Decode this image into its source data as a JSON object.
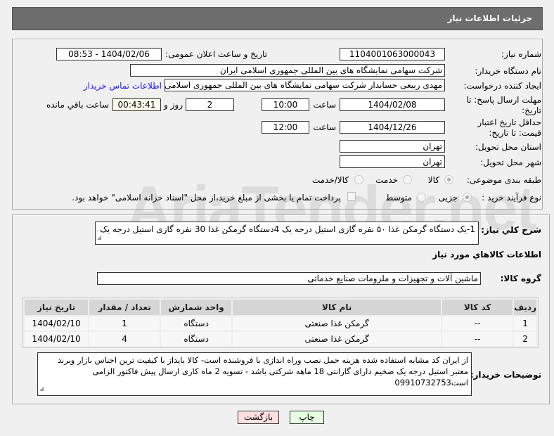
{
  "header": {
    "title": "جزئیات اطلاعات نیاز"
  },
  "form": {
    "need_number_label": "شماره نیاز:",
    "need_number": "1104001063000043",
    "announce_label": "تاریخ و ساعت اعلان عمومی:",
    "announce_value": "1404/02/06 - 08:53",
    "buyer_label": "نام دستگاه خریدار:",
    "buyer_value": "شرکت سهامی نمایشگاه های بین المللی جمهوری اسلامی ایران",
    "creator_label": "ایجاد کننده درخواست:",
    "creator_value": "مهدی  ربیعی حسابدار شرکت سهامی نمایشگاه های بین المللی جمهوری اسلامی ایران",
    "contact_link": "اطلاعات تماس خریدار",
    "deadline_label": "مهلت ارسال پاسخ: تا تاریخ:",
    "deadline_date": "1404/02/08",
    "time_label": "ساعت",
    "deadline_time": "10:00",
    "days": "2",
    "days_label": "روز و",
    "remaining": "00:43:41",
    "remaining_label": "ساعت باقي مانده",
    "validity_label": "حداقل تاریخ اعتبار قیمت: تا تاریخ:",
    "validity_date": "1404/12/26",
    "validity_time": "12:00",
    "province_label": "استان محل تحویل:",
    "province": "تهران",
    "city_label": "شهر محل تحویل:",
    "city": "تهران",
    "category_label": "طبقه بندی موضوعی:",
    "category_options": [
      "کالا",
      "خدمت",
      "کالا/خدمت"
    ],
    "category_selected": "کالا",
    "process_label": "نوع فرآیند خرید :",
    "process_options": [
      "جزیی",
      "متوسط"
    ],
    "process_selected": "جزیی",
    "payment_text": "پرداخت تمام یا بخشی از مبلغ خرید،از محل \"اسناد خزانه اسلامی\" خواهد بود."
  },
  "details": {
    "summary_label": "شرح کلي نياز:",
    "summary": "1-یک دستگاه گرمکن غذا ۵۰ نفره گازی استیل درجه یک 4دستگاه گرمکن غذا 30 نفره گازی استیل درجه یک",
    "goods_title": "اطلاعات کالاهاي مورد نياز",
    "group_label": "گروه کالا:",
    "group_value": "ماشین آلات و تجهیزات و ملزومات صنایع خدماتی",
    "table": {
      "headers": [
        "ردیف",
        "کد کالا",
        "نام کالا",
        "واحد شمارش",
        "تعداد / مقدار",
        "تاریخ نیاز"
      ],
      "rows": [
        [
          "1",
          "--",
          "گرمکن غذا صنعتی",
          "دستگاه",
          "1",
          "1404/02/10"
        ],
        [
          "2",
          "--",
          "گرمکن غذا صنعتی",
          "دستگاه",
          "4",
          "1404/02/10"
        ]
      ]
    },
    "notes_label": "توضیحات خریدار:",
    "notes": "از ایران کد مشابه استفاده شده هزینه حمل نصب وراه اندازی با فروشنده است- کالا بایداز با کیفیت ترین اجناس بازار وبرند معتبر استیل درجه یک ضخیم دارای گارانتی 18 ماهه شرکتی باشد - تسویه 2 ماه کاری ارسال پیش فاکتور الزامی است09910732753"
  },
  "buttons": {
    "print": "چاپ",
    "back": "بازگشت"
  },
  "watermark": "AriaTender.net"
}
